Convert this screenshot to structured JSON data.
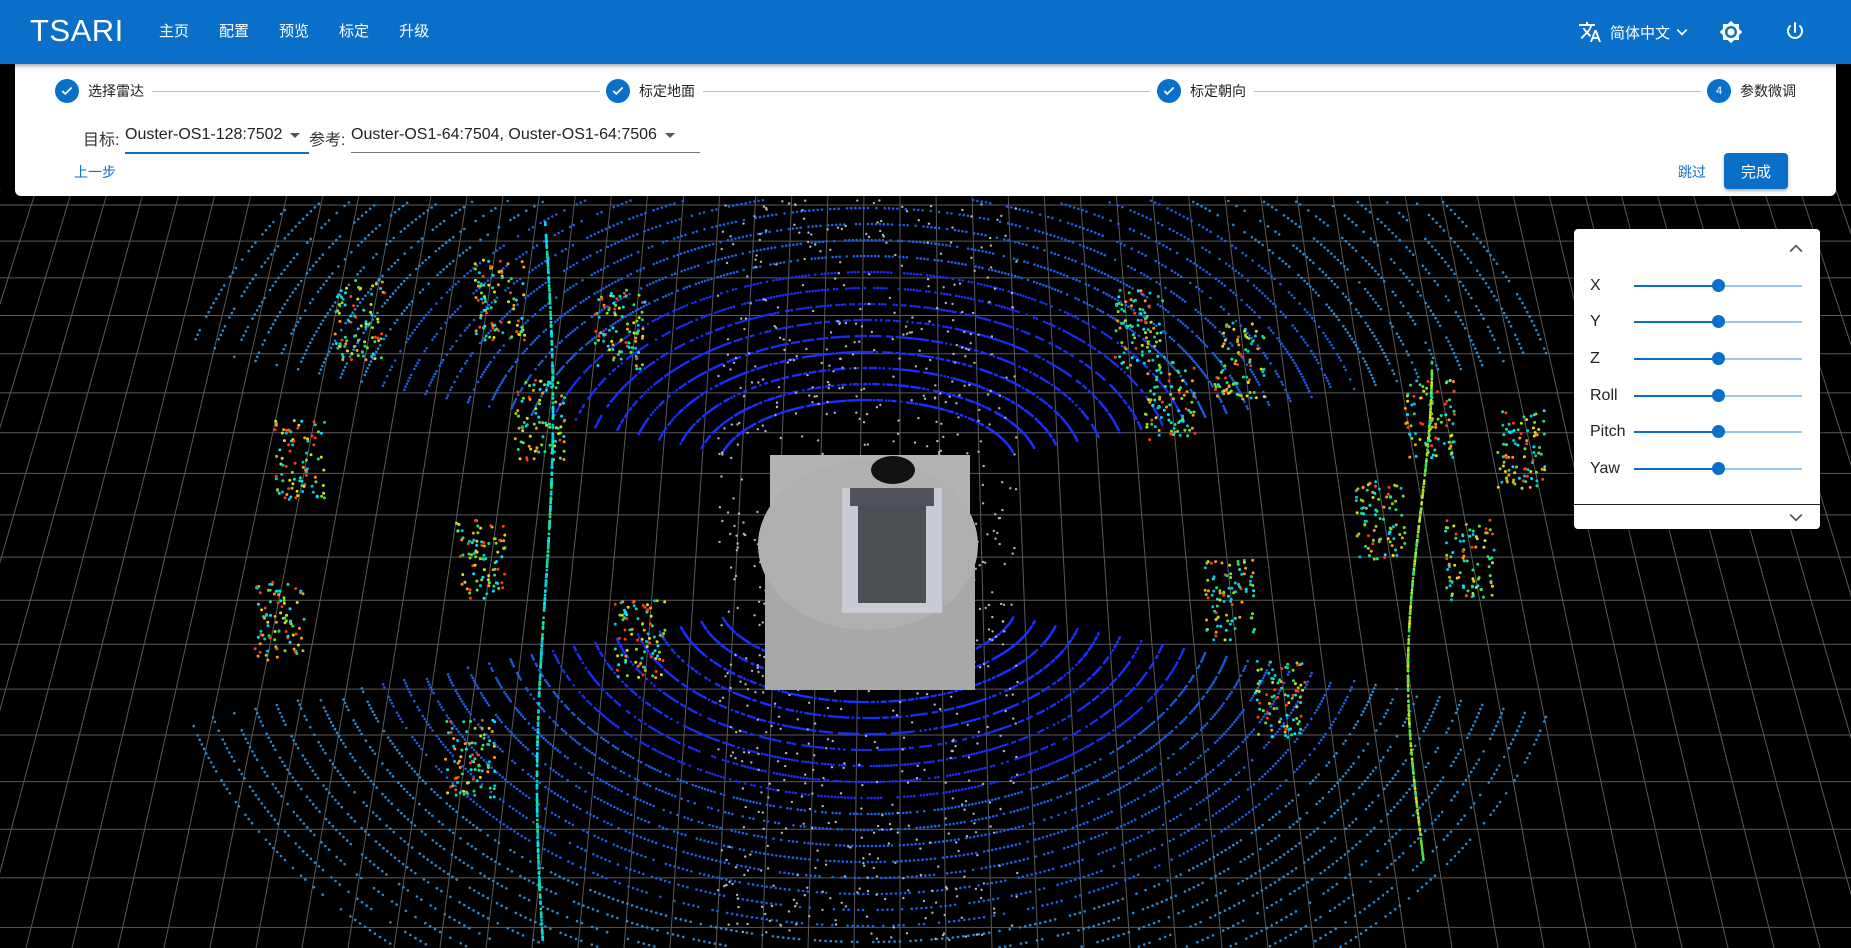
{
  "app": {
    "brand": "TSARI",
    "nav": [
      "主页",
      "配置",
      "预览",
      "标定",
      "升级"
    ],
    "language": "简体中文",
    "accent_color": "#0a6fc9",
    "icons": [
      "translate-icon",
      "chevron-down-icon",
      "brightness-icon",
      "power-icon"
    ]
  },
  "stepper": {
    "steps": [
      {
        "label": "选择雷达",
        "state": "done"
      },
      {
        "label": "标定地面",
        "state": "done"
      },
      {
        "label": "标定朝向",
        "state": "done"
      },
      {
        "label": "参数微调",
        "state": "active",
        "number": "4"
      }
    ]
  },
  "form": {
    "target_label": "目标:",
    "target_value": "Ouster-OS1-128:7502",
    "reference_label": "参考:",
    "reference_value": "Ouster-OS1-64:7504, Ouster-OS1-64:7506",
    "prev_label": "上一步",
    "skip_label": "跳过",
    "finish_label": "完成"
  },
  "panel": {
    "sliders": [
      {
        "label": "X",
        "value": 0.5
      },
      {
        "label": "Y",
        "value": 0.5
      },
      {
        "label": "Z",
        "value": 0.5
      },
      {
        "label": "Roll",
        "value": 0.5
      },
      {
        "label": "Pitch",
        "value": 0.5
      },
      {
        "label": "Yaw",
        "value": 0.5
      }
    ]
  }
}
